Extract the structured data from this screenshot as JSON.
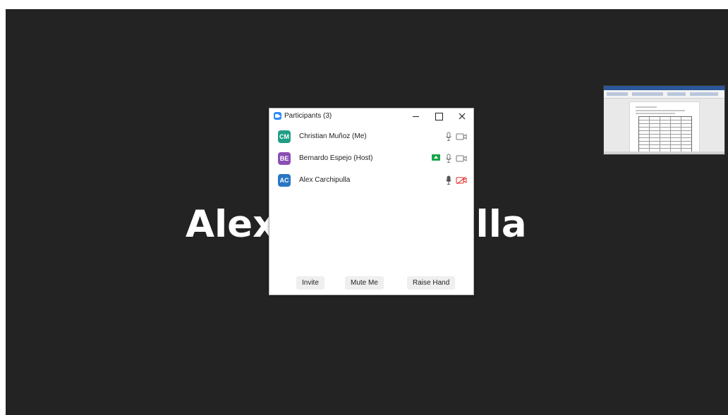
{
  "meeting": {
    "active_speaker_name": "Alex Carchipulla",
    "background_color": "#232323"
  },
  "participants_window": {
    "title": "Participants (3)",
    "participants": [
      {
        "initials": "CM",
        "name": "Christian Muñoz (Me)",
        "avatar_color": "#1f9e86",
        "mic": "unmuted",
        "video": "off",
        "sharing": false
      },
      {
        "initials": "BE",
        "name": "Bernardo Espejo (Host)",
        "avatar_color": "#8b4fb4",
        "mic": "unmuted",
        "video": "off",
        "sharing": true
      },
      {
        "initials": "AC",
        "name": "Alex Carchipulla",
        "avatar_color": "#2877c5",
        "mic": "active",
        "video": "disabled",
        "sharing": false
      }
    ],
    "buttons": {
      "invite": "Invite",
      "mute_me": "Mute Me",
      "raise_hand": "Raise Hand"
    }
  },
  "screen_share_thumbnail": {
    "icon": "document-thumbnail-icon"
  }
}
